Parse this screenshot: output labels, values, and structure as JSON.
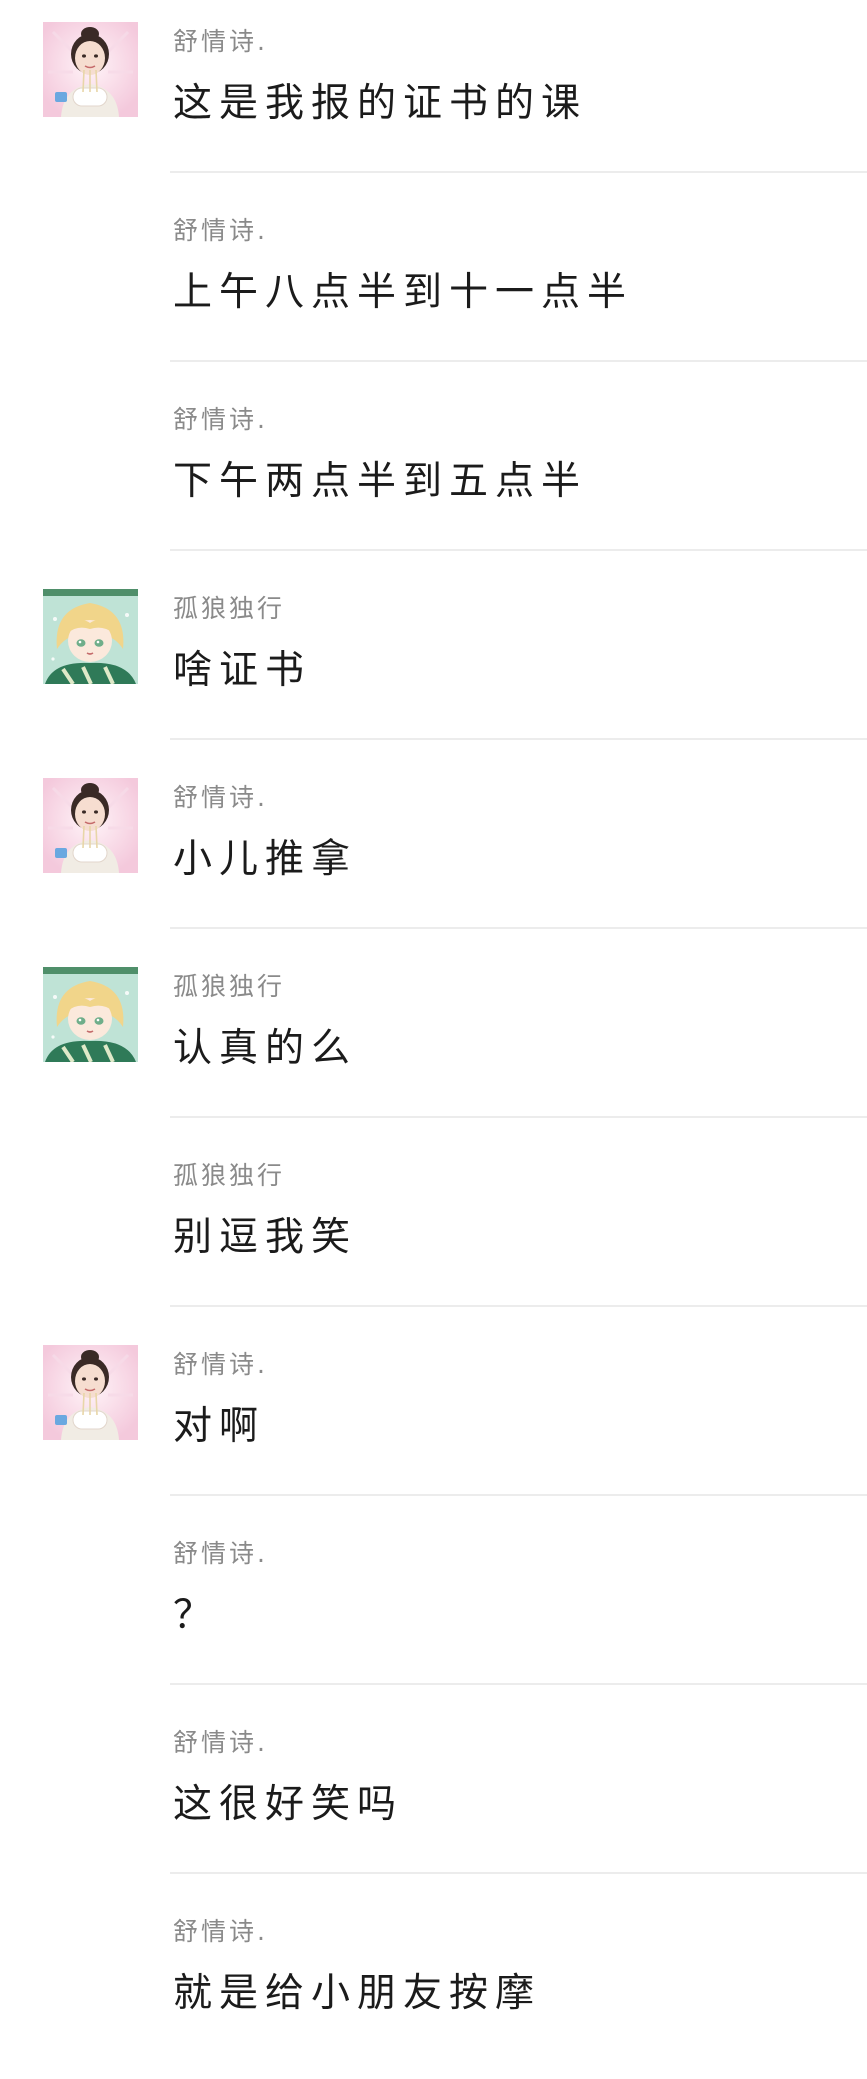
{
  "messages": [
    {
      "sender": "舒情诗.",
      "avatar": "girl-avatar",
      "show_avatar": true,
      "text": "这是我报的证书的课"
    },
    {
      "sender": "舒情诗.",
      "avatar": "girl-avatar",
      "show_avatar": false,
      "text": "上午八点半到十一点半"
    },
    {
      "sender": "舒情诗.",
      "avatar": "girl-avatar",
      "show_avatar": false,
      "text": "下午两点半到五点半"
    },
    {
      "sender": "孤狼独行",
      "avatar": "anime-boy-avatar",
      "show_avatar": true,
      "text": "啥证书"
    },
    {
      "sender": "舒情诗.",
      "avatar": "girl-avatar",
      "show_avatar": true,
      "text": "小儿推拿"
    },
    {
      "sender": "孤狼独行",
      "avatar": "anime-boy-avatar",
      "show_avatar": true,
      "text": "认真的么"
    },
    {
      "sender": "孤狼独行",
      "avatar": "anime-boy-avatar",
      "show_avatar": false,
      "text": "别逗我笑"
    },
    {
      "sender": "舒情诗.",
      "avatar": "girl-avatar",
      "show_avatar": true,
      "text": "对啊"
    },
    {
      "sender": "舒情诗.",
      "avatar": "girl-avatar",
      "show_avatar": false,
      "text": "？"
    },
    {
      "sender": "舒情诗.",
      "avatar": "girl-avatar",
      "show_avatar": false,
      "text": "这很好笑吗"
    },
    {
      "sender": "舒情诗.",
      "avatar": "girl-avatar",
      "show_avatar": false,
      "text": "就是给小朋友按摩"
    }
  ],
  "colors": {
    "sender_text": "#8a8a8a",
    "message_text": "#1b1b1b",
    "divider": "#ececec",
    "background": "#ffffff"
  }
}
